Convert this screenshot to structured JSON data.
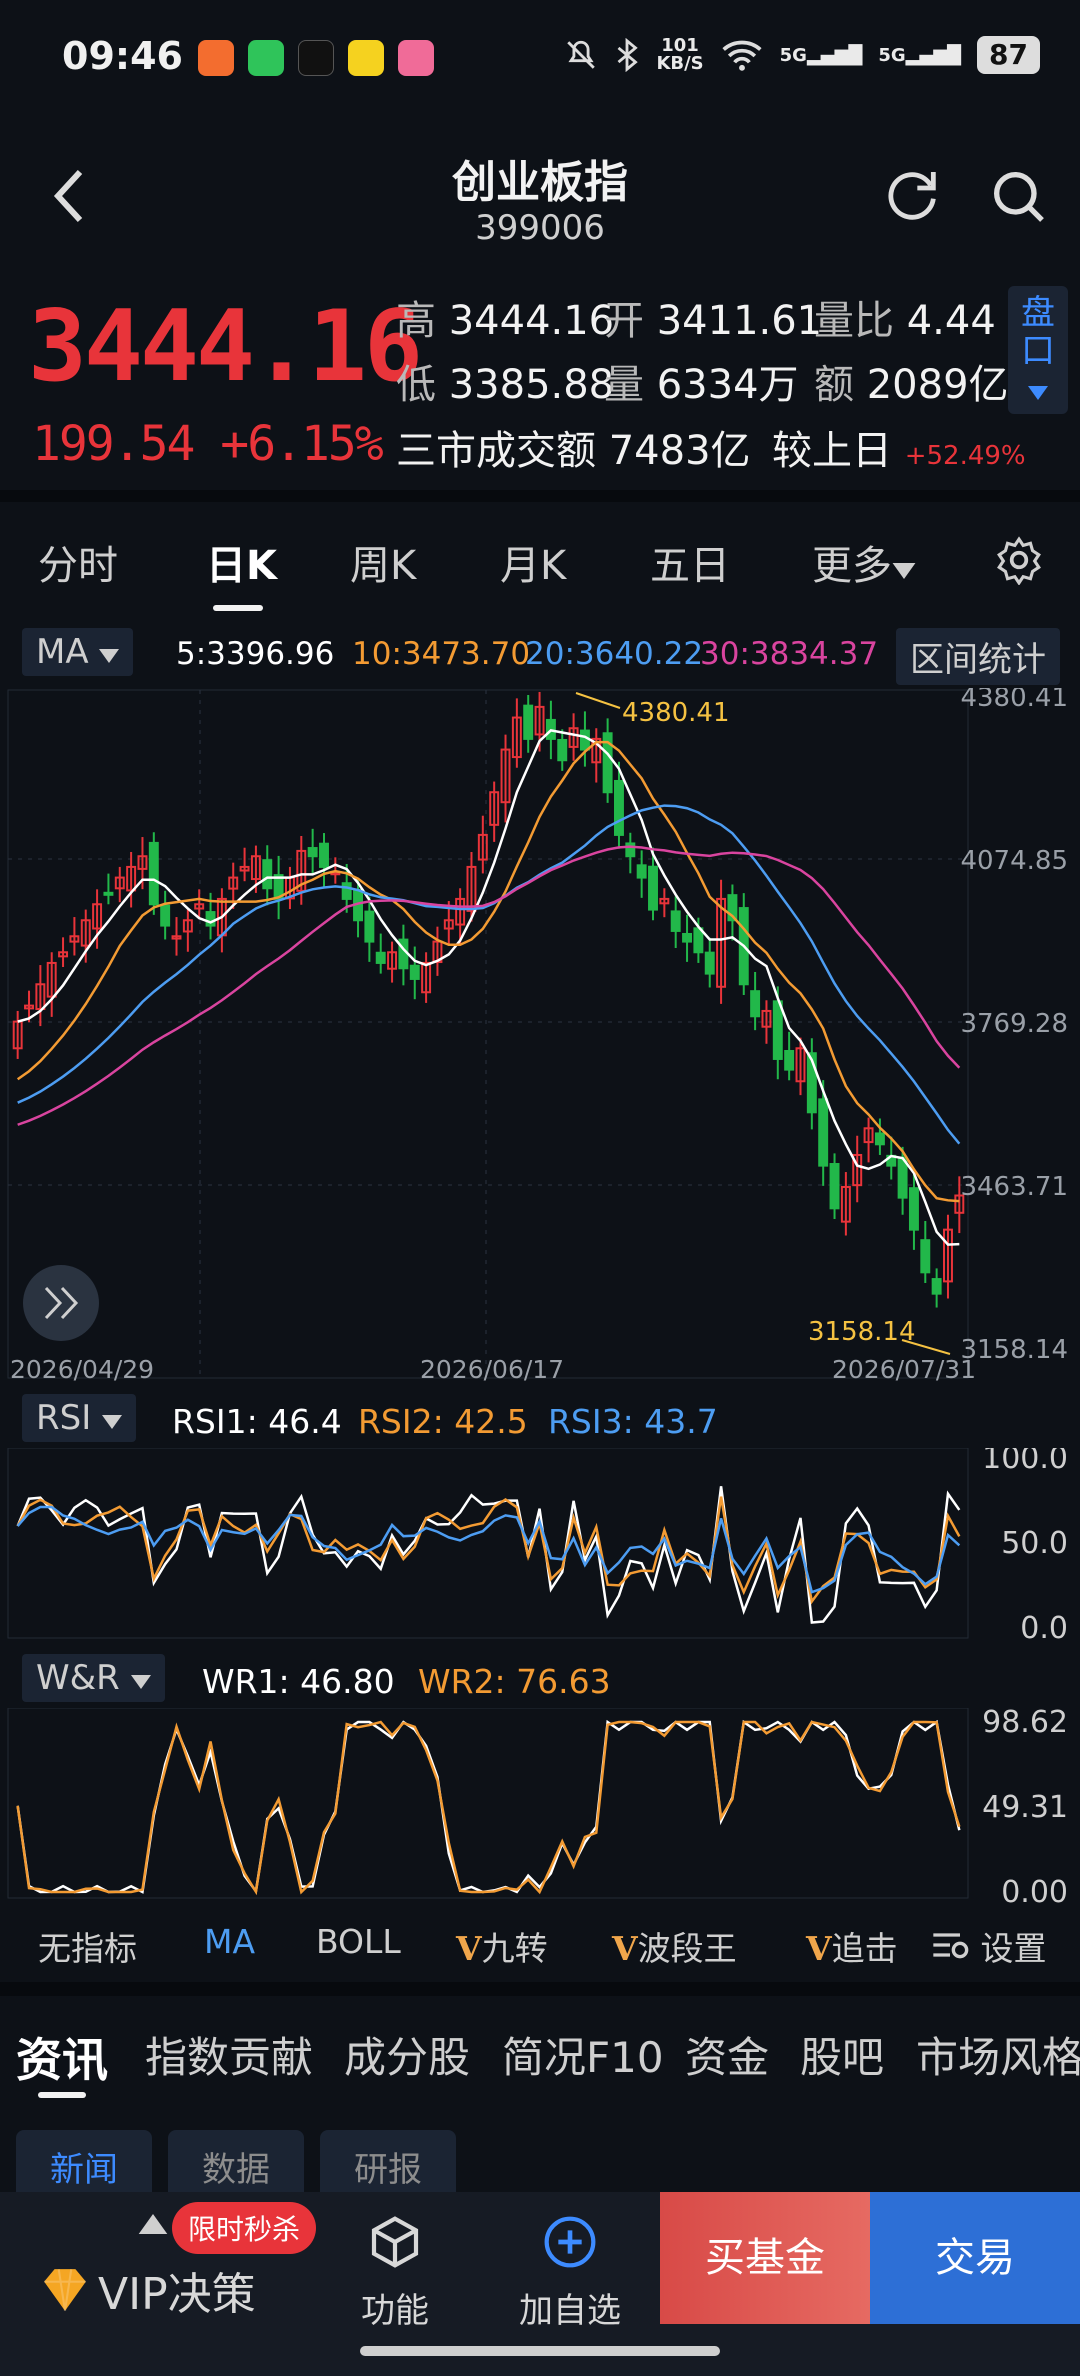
{
  "status": {
    "time": "09:46",
    "net_speed_top": "101",
    "net_speed_bottom": "KB/S",
    "sim1": "5G",
    "sim2": "5G",
    "battery": "87"
  },
  "header": {
    "title": "创业板指",
    "code": "399006"
  },
  "quote": {
    "price": "3444.16",
    "change_abs": "199.54",
    "change_pct": "+6.15%",
    "high_label": "高",
    "high": "3444.16",
    "open_label": "开",
    "open": "3411.61",
    "ratio_label": "量比",
    "ratio": "4.44",
    "low_label": "低",
    "low": "3385.88",
    "vol_label": "量",
    "vol": "6334万",
    "amt_label": "额",
    "amt": "2089亿",
    "market_label": "三市成交额",
    "market_amt": "7483亿",
    "vs_label": "较上日",
    "vs_pct": "+52.49%",
    "pankou": "盘口"
  },
  "tabs": [
    "分时",
    "日K",
    "周K",
    "月K",
    "五日",
    "更多"
  ],
  "ma": {
    "selector": "MA",
    "ma5": "5:3396.96",
    "ma10": "10:3473.70",
    "ma20": "20:3640.22",
    "ma30": "30:3834.37",
    "stats_button": "区间统计"
  },
  "kline": {
    "axis_labels": [
      "4380.41",
      "4074.85",
      "3769.28",
      "3463.71",
      "3158.14"
    ],
    "max_label": "4380.41",
    "min_label": "3158.14",
    "dates": [
      "2026/04/29",
      "2026/06/17",
      "2026/07/31"
    ]
  },
  "rsi": {
    "selector": "RSI",
    "rsi1": "RSI1: 46.4",
    "rsi2": "RSI2: 42.5",
    "rsi3": "RSI3: 43.7",
    "axis": [
      "100.0",
      "50.0",
      "0.0"
    ]
  },
  "wr": {
    "selector": "W&R",
    "wr1": "WR1: 46.80",
    "wr2": "WR2: 76.63",
    "axis": [
      "98.62",
      "49.31",
      "0.00"
    ]
  },
  "indicators": {
    "none": "无指标",
    "ma": "MA",
    "boll": "BOLL",
    "jiuzhuan": "九转",
    "boduanwang": "波段王",
    "zhuiji": "追击",
    "settings": "设置",
    "v": "V"
  },
  "news_nav": [
    "资讯",
    "指数贡献",
    "成分股",
    "简况F10",
    "资金",
    "股吧",
    "市场风格"
  ],
  "sub_tabs": [
    "新闻",
    "数据",
    "研报"
  ],
  "bottom": {
    "flash": "限时秒杀",
    "vip": "VIP决策",
    "func": "功能",
    "add": "加自选",
    "buy_fund": "买基金",
    "trade": "交易"
  },
  "colors": {
    "up": "#e8343a",
    "down": "#22b84a",
    "ma5": "#ffffff",
    "ma10": "#f39b33",
    "ma20": "#4d9df2",
    "ma30": "#d9449f",
    "accent": "#3d8bff"
  }
}
